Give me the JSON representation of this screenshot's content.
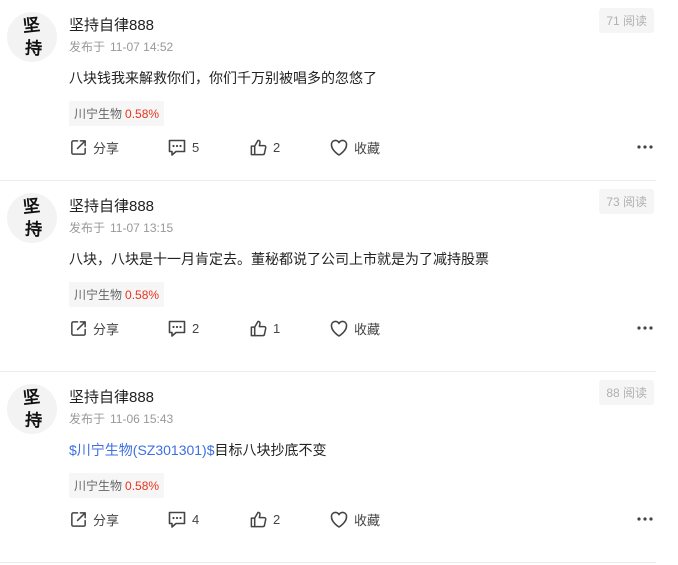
{
  "posts": [
    {
      "avatar_chars": [
        "坚",
        "持"
      ],
      "username": "坚持自律888",
      "published_prefix": "发布于",
      "published_time": "11-07 14:52",
      "read_count": "71 阅读",
      "content_link": "",
      "content_text": "八块钱我来解救你们，你们千万别被唱多的忽悠了",
      "stock_name": "川宁生物",
      "stock_change": "0.58%",
      "share_label": "分享",
      "comment_count": "5",
      "like_count": "2",
      "favorite_label": "收藏"
    },
    {
      "avatar_chars": [
        "坚",
        "持"
      ],
      "username": "坚持自律888",
      "published_prefix": "发布于",
      "published_time": "11-07 13:15",
      "read_count": "73 阅读",
      "content_link": "",
      "content_text": "八块，八块是十一月肯定去。董秘都说了公司上市就是为了减持股票",
      "stock_name": "川宁生物",
      "stock_change": "0.58%",
      "share_label": "分享",
      "comment_count": "2",
      "like_count": "1",
      "favorite_label": "收藏"
    },
    {
      "avatar_chars": [
        "坚",
        "持"
      ],
      "username": "坚持自律888",
      "published_prefix": "发布于",
      "published_time": "11-06 15:43",
      "read_count": "88 阅读",
      "content_link": "$川宁生物(SZ301301)$",
      "content_text": "目标八块抄底不变",
      "stock_name": "川宁生物",
      "stock_change": "0.58%",
      "share_label": "分享",
      "comment_count": "4",
      "like_count": "2",
      "favorite_label": "收藏"
    }
  ],
  "icons": {
    "share": "share-icon",
    "comment": "comment-icon",
    "like": "thumbs-up-icon",
    "favorite": "heart-icon",
    "more": "more-dots-icon"
  },
  "colors": {
    "link": "#3d6fe0",
    "stock_up": "#e8331e",
    "meta": "#999999"
  }
}
